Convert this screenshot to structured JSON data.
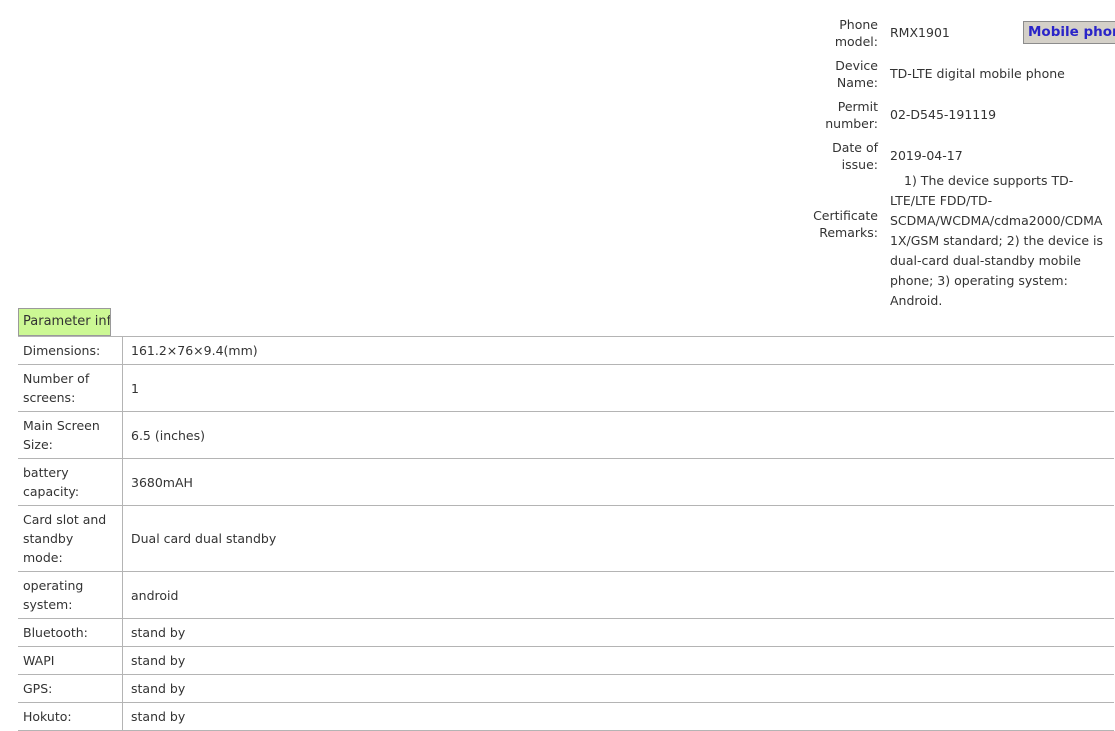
{
  "certificate": {
    "rows": [
      {
        "label": "Phone model:",
        "value": "RMX1901"
      },
      {
        "label": "Device Name:",
        "value": "TD-LTE digital mobile phone"
      },
      {
        "label": "Permit number:",
        "value": "02-D545-191119"
      },
      {
        "label": "Date of issue:",
        "value": "2019-04-17"
      },
      {
        "label": "Certificate Remarks:",
        "value": "1) The device supports TD-LTE/LTE FDD/TD-SCDMA/WCDMA/cdma2000/CDMA 1X/GSM standard; 2) the device is dual-card dual-standby mobile phone; 3) operating system: Android."
      }
    ],
    "badge": {
      "text": "Mobile phon",
      "text_color": "#2a24c8",
      "background_color": "#d4d0c8",
      "border_color": "#8c8c8c"
    }
  },
  "parameters": {
    "title": "Parameter info",
    "title_background_color": "#ccf894",
    "border_color": "#b4b4b4",
    "rows": [
      {
        "label": "Dimensions:",
        "value": "161.2×76×9.4(mm)",
        "lines": 1
      },
      {
        "label": "Number of screens:",
        "value": "1",
        "lines": 2
      },
      {
        "label": "Main Screen Size:",
        "value": "6.5 (inches)",
        "lines": 2
      },
      {
        "label": "battery capacity:",
        "value": "3680mAH",
        "lines": 2
      },
      {
        "label": "Card slot and standby mode:",
        "value": "Dual card dual standby",
        "lines": 2
      },
      {
        "label": "operating system:",
        "value": "android",
        "lines": 2
      },
      {
        "label": "Bluetooth:",
        "value": "stand by",
        "lines": 1
      },
      {
        "label": "WAPI",
        "value": "stand by",
        "lines": 1
      },
      {
        "label": "GPS:",
        "value": "stand by",
        "lines": 1
      },
      {
        "label": "Hokuto:",
        "value": "stand by",
        "lines": 1
      }
    ]
  }
}
